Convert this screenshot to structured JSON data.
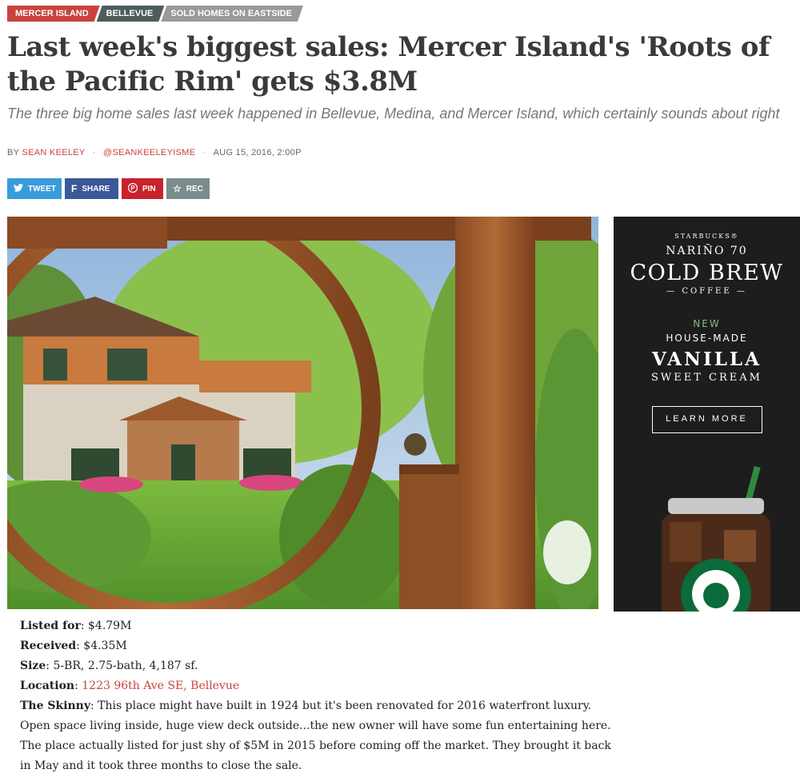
{
  "tags": [
    {
      "label": "MERCER ISLAND",
      "color": "#c9433c"
    },
    {
      "label": "BELLEVUE",
      "color": "#4d5c5c"
    },
    {
      "label": "SOLD HOMES ON EASTSIDE",
      "color": "#9a9a9a"
    }
  ],
  "article": {
    "headline": "Last week's biggest sales: Mercer Island's 'Roots of the Pacific Rim' gets $3.8M",
    "deck": "The three big home sales last week happened in Bellevue, Medina, and Mercer Island, which certainly sounds about right",
    "byline": {
      "by": "BY",
      "author": "SEAN KEELEY",
      "handle": "@SEANKEELEYISME",
      "date": "AUG 15, 2016, 2:00P"
    }
  },
  "share": {
    "tweet": "TWEET",
    "share": "SHARE",
    "pin": "PIN",
    "rec": "REC"
  },
  "ad": {
    "brand": "STARBUCKS®",
    "line1": "NARIÑO 70",
    "line2": "COLD BREW",
    "line3": "— COFFEE —",
    "new": "NEW",
    "line4": "HOUSE-MADE",
    "line5": "VANILLA",
    "line6": "SWEET CREAM",
    "cta": "LEARN MORE"
  },
  "listing": {
    "listed_label": "Listed for",
    "listed_value": "$4.79M",
    "received_label": "Received",
    "received_value": "$4.35M",
    "size_label": "Size",
    "size_value": "5-BR, 2.75-bath, 4,187 sf.",
    "location_label": "Location",
    "location_value": "1223 96th Ave SE, Bellevue",
    "skinny_label": "The Skinny",
    "skinny_value": "This place might have built in 1924 but it's been renovated for 2016 waterfront luxury. Open space living inside, huge view deck outside...the new owner will have some fun entertaining here. The place actually listed for just shy of $5M in 2015 before coming off the market. They brought it back in May and it took three months to close the sale."
  },
  "colors": {
    "accent": "#c9433c",
    "twitter": "#3a9bdb",
    "facebook": "#3b5998",
    "pinterest": "#c8232c",
    "rec": "#7a8c8c"
  }
}
